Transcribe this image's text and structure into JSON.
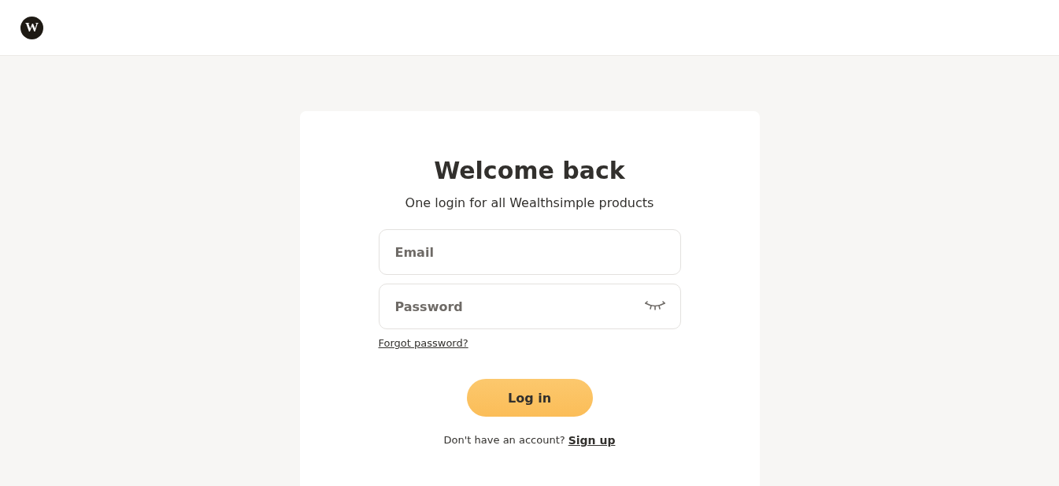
{
  "header": {
    "logo": "W"
  },
  "card": {
    "title": "Welcome back",
    "subtitle": "One login for all Wealthsimple products",
    "fields": [
      {
        "kind": "text",
        "placeholder": "Email"
      },
      {
        "kind": "password",
        "placeholder": "Password"
      }
    ],
    "forgot_link": "Forgot password?",
    "login_button": "Log in",
    "signup_prompt": "Don't have an account?",
    "signup_link": "Sign up"
  }
}
